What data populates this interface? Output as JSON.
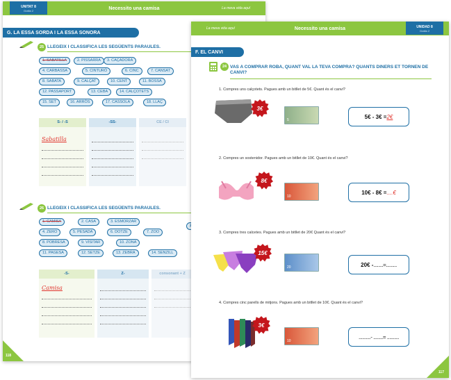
{
  "left": {
    "unit_label": "UNITAT 8",
    "unit_sub": "Grafia 2",
    "title": "Necessito una camisa",
    "tagline": "La meva vida aquí",
    "section": "G. LA ESSA SORDA I LA ESSA SONORA",
    "ex25": {
      "num": "25",
      "instruction": "LLEGEIX I CLASSIFICA LES SEGÜENTS PARAULES.",
      "words": [
        "1. SABATILLA",
        "2. PISSARRA",
        "3. CAÇADORA",
        "4. CARBASSA",
        "5. CINTURÓ",
        "6. CINC",
        "7. CANSAT",
        "8. SABATA",
        "9. CALÇAT",
        "10. CENT",
        "11. BOSSA",
        "12. PASSAPORT",
        "13. CEBA",
        "14. CALÇOTETS",
        "15. SET",
        "16. ARRÒS",
        "17. CASSOLA",
        "18. LLAÇ"
      ],
      "cols": [
        "S- / -S",
        "-SS-",
        "CE / CI"
      ],
      "handwritten": "Sabatilla"
    },
    "ex26": {
      "num": "26",
      "instruction": "LLEGEIX I CLASSIFICA LES SEGÜENTS PARAULES.",
      "words": [
        "1. CAMISA",
        "2. CASA",
        "3. ESMORZAR",
        "4. ZERO",
        "5. PESADA",
        "6. DOTZE",
        "7. ZOO",
        "8. POBRESA",
        "9. VISITAR",
        "10. ZONA",
        "11. PAGESA",
        "12. SETZE",
        "13. ZEBRA",
        "14. SENZILL"
      ],
      "cols": [
        "-S-",
        "Z-",
        "consonant + Z"
      ],
      "handwritten": "Camisa",
      "cut_letter": "Z"
    },
    "page_num": "118"
  },
  "right": {
    "tagline": "La meva vida aquí",
    "title": "Necessito una camisa",
    "unit_label": "UNIDAD 8",
    "unit_sub": "Grafia 2",
    "section": "F. EL CANVI",
    "ex24": {
      "num": "24",
      "instruction": "VAS A COMPRAR ROBA, QUANT VAL LA TEVA COMPRA? QUANTS DINERS ET TORNEN DE CANVI?"
    },
    "questions": [
      {
        "text": "1.  Compres uns calçotets. Pagues amb un bitllet de 5€. Quant és el canvi?",
        "price": "3€",
        "note": "5",
        "eq": "5€ - 3€ = ",
        "ans": "2€",
        "item": "underwear-image"
      },
      {
        "text": "2.  Compres un sostenidor. Pagues amb un bitllet de 10€. Quant és el canvi?",
        "price": "8€",
        "note": "10",
        "eq": "10€ - 8€ = ",
        "ans": "....€",
        "item": "bra-image"
      },
      {
        "text": "3.  Compres tres calcetes. Pagues amb un bitllet de 20€ Quant és el canvi?",
        "price": "15€",
        "note": "20",
        "eq": "20€ - ",
        "ans": "........=.........",
        "item": "panties-image"
      },
      {
        "text": "4.  Compres cinc parells de mitjons. Pagues amb un bitllet de 10€. Quant és el canvi?",
        "price": "3€",
        "note": "10",
        "eq": "",
        "ans": "..........- ........= ..........",
        "item": "socks-image"
      }
    ],
    "page_num": "117"
  },
  "colors": {
    "green": "#8cc640",
    "blue": "#1e6fa5",
    "red": "#e0322b"
  }
}
